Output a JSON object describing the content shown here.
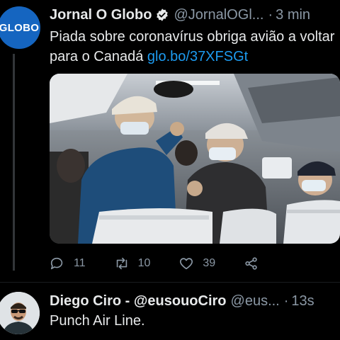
{
  "tweet": {
    "avatar_text": "GLOBO",
    "name": "Jornal O Globo",
    "handle": "@JornalOGl...",
    "separator": "·",
    "time": "3 min",
    "text": "Piada sobre coronavírus obriga avião a voltar para o Canadá",
    "link": "glo.bo/37XFSGt",
    "actions": {
      "reply_count": "11",
      "retweet_count": "10",
      "like_count": "39"
    }
  },
  "reply": {
    "name": "Diego Ciro - @eusouoCiro",
    "handle": "@eus...",
    "separator": "·",
    "time": "13s",
    "text": "Punch Air Line."
  },
  "colors": {
    "background": "#000000",
    "text": "#e7e9ea",
    "secondary": "#8b98a5",
    "link": "#1d9bf0",
    "brand": "#1565c0"
  },
  "icons": [
    "verified-badge-icon",
    "reply-icon",
    "retweet-icon",
    "like-icon",
    "share-icon"
  ]
}
